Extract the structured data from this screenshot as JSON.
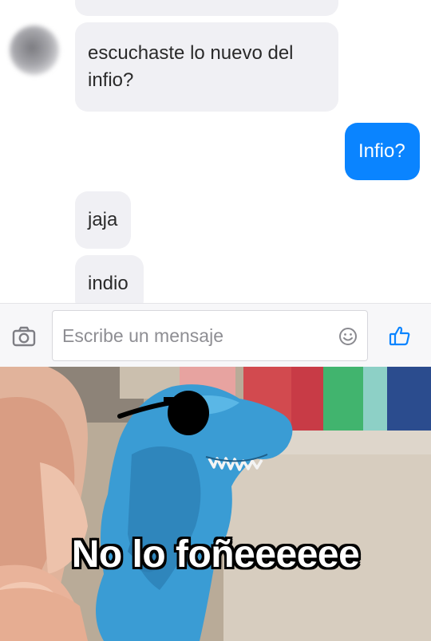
{
  "conversation": {
    "messages": [
      {
        "side": "in",
        "text": ""
      },
      {
        "side": "in",
        "text": "escuchaste lo nuevo del infio?"
      },
      {
        "side": "out",
        "text": "Infio?"
      },
      {
        "side": "in",
        "text": "jaja"
      },
      {
        "side": "in",
        "text": "indio"
      }
    ],
    "msg1_line1": "escuchaste lo nuevo del",
    "msg1_line2": "infio?",
    "msg2": "Infio?",
    "msg3": "jaja",
    "msg4": "indio"
  },
  "composer": {
    "placeholder": "Escribe un mensaje",
    "icons": {
      "left": "camera-icon",
      "inline": "emoji-icon",
      "right": "thumbs-up-icon"
    }
  },
  "meme": {
    "caption": "No lo foñeeeeee",
    "subject": "blue toy dinosaur wearing sunglasses"
  },
  "colors": {
    "incoming_bubble": "#f0f0f4",
    "outgoing_bubble": "#0a84ff",
    "accent": "#0a84ff",
    "dino": "#3a9cd4"
  }
}
